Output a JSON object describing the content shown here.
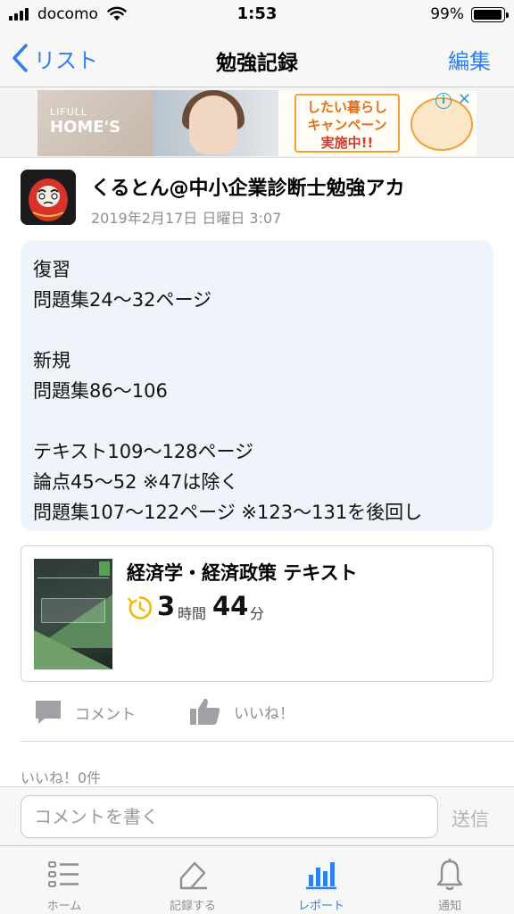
{
  "status_bar": {
    "carrier": "docomo",
    "time": "1:53",
    "battery": "99%"
  },
  "nav": {
    "back_label": "リスト",
    "title": "勉強記録",
    "edit_label": "編集"
  },
  "ad": {
    "logo_small": "LIFULL",
    "logo_big": "HOME'S",
    "copy_lines": [
      "したい暮らし",
      "キャンペーン",
      "実施中!!"
    ],
    "info_symbol": "i",
    "close_symbol": "✕"
  },
  "post": {
    "author": "くるとん@中小企業診断士勉強アカ",
    "date": "2019年2月17日 日曜日 3:07",
    "note_lines": [
      "復習",
      "問題集24〜32ページ",
      "",
      "新規",
      "問題集86〜106",
      "",
      "テキスト109〜128ページ",
      "論点45〜52 ※47は除く",
      "問題集107〜122ページ ※123〜131を後回し"
    ]
  },
  "study": {
    "book_title": "経済学・経済政策 テキスト",
    "hours": "3",
    "hours_unit": "時間",
    "minutes": "44",
    "minutes_unit": "分"
  },
  "actions": {
    "comment_label": "コメント",
    "like_label": "いいね！"
  },
  "likes": {
    "count_text": "いいね！0件"
  },
  "composer": {
    "placeholder": "コメントを書く",
    "send_label": "送信"
  },
  "tabs": [
    {
      "label": "ホーム",
      "icon": "list-icon",
      "active": false
    },
    {
      "label": "記録する",
      "icon": "pencil-icon",
      "active": false
    },
    {
      "label": "レポート",
      "icon": "bar-chart-icon",
      "active": true
    },
    {
      "label": "通知",
      "icon": "bell-icon",
      "active": false
    }
  ],
  "colors": {
    "accent": "#2f80ed",
    "note_bg": "#eef4f9",
    "timer": "#f5b800",
    "muted": "#8e8e93"
  }
}
